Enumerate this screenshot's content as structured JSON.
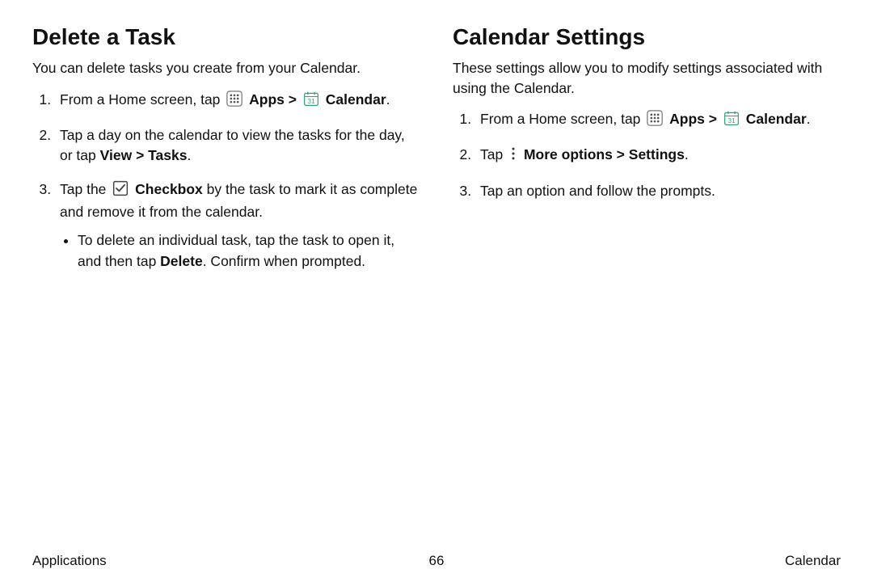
{
  "left": {
    "title": "Delete a Task",
    "intro": "You can delete tasks you create from your Calendar.",
    "step1_pre": "From a Home screen, tap ",
    "apps_label": "Apps",
    "sep": " > ",
    "calendar_label": "Calendar",
    "step2_a": "Tap a day on the calendar to view the tasks for the day, or tap ",
    "view_label": "View",
    "tasks_label": "Tasks",
    "step3_a": "Tap the ",
    "checkbox_label": "Checkbox",
    "step3_b": " by the task to mark it as complete and remove it from the calendar.",
    "sub1_a": "To delete an individual task, tap the task to open it, and then tap ",
    "delete_label": "Delete",
    "sub1_b": ". Confirm when prompted."
  },
  "right": {
    "title": "Calendar Settings",
    "intro": "These settings allow you to modify settings associated with using the Calendar.",
    "step1_pre": "From a Home screen, tap ",
    "apps_label": "Apps",
    "sep": " > ",
    "calendar_label": "Calendar",
    "step2_a": "Tap ",
    "more_label": "More options",
    "settings_label": "Settings",
    "step3": "Tap an option and follow the prompts."
  },
  "footer": {
    "left": "Applications",
    "center": "66",
    "right": "Calendar"
  },
  "punct": {
    "period": "."
  }
}
